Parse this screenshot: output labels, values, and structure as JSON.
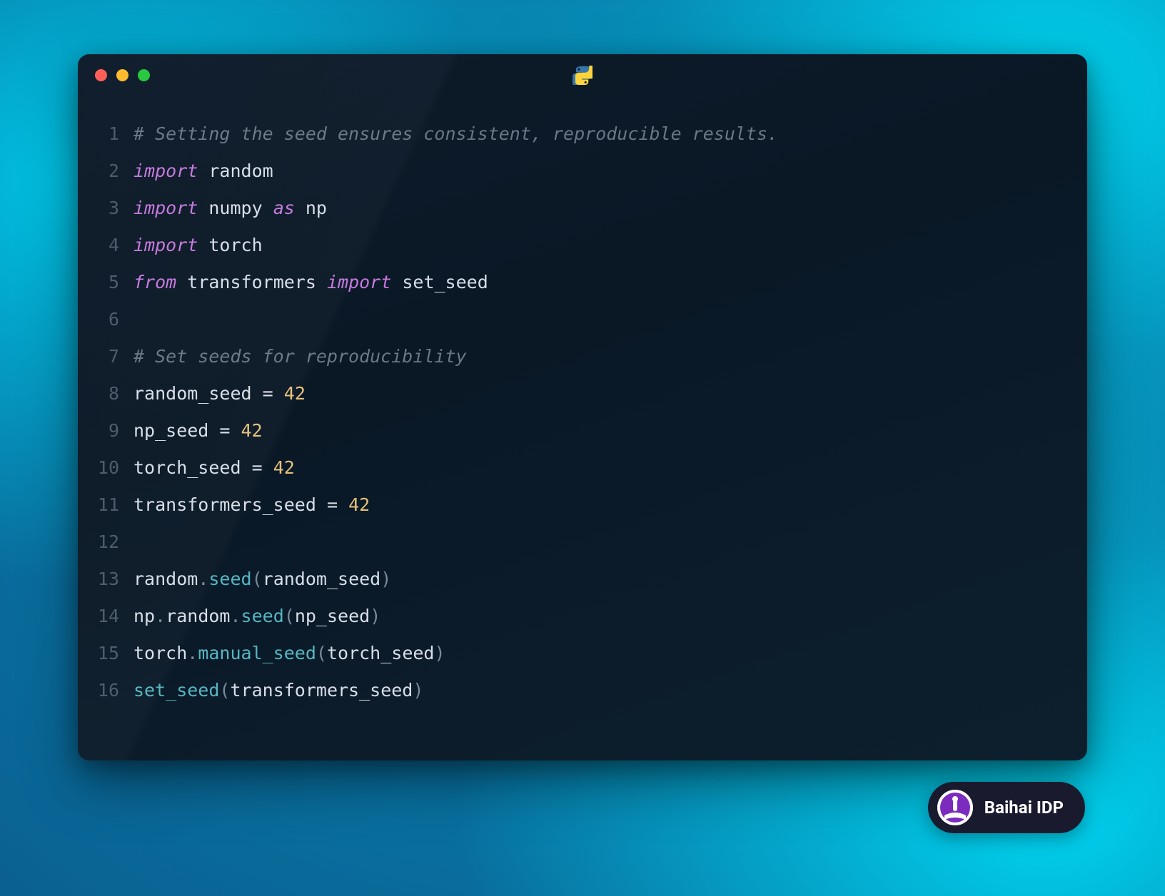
{
  "window": {
    "language": "python"
  },
  "code": {
    "lines": [
      {
        "n": "1",
        "tokens": [
          {
            "t": "comment",
            "v": "# Setting the seed ensures consistent, reproducible results."
          }
        ]
      },
      {
        "n": "2",
        "tokens": [
          {
            "t": "keyword",
            "v": "import"
          },
          {
            "t": "space",
            "v": " "
          },
          {
            "t": "identifier",
            "v": "random"
          }
        ]
      },
      {
        "n": "3",
        "tokens": [
          {
            "t": "keyword",
            "v": "import"
          },
          {
            "t": "space",
            "v": " "
          },
          {
            "t": "identifier",
            "v": "numpy"
          },
          {
            "t": "space",
            "v": " "
          },
          {
            "t": "keyword",
            "v": "as"
          },
          {
            "t": "space",
            "v": " "
          },
          {
            "t": "identifier",
            "v": "np"
          }
        ]
      },
      {
        "n": "4",
        "tokens": [
          {
            "t": "keyword",
            "v": "import"
          },
          {
            "t": "space",
            "v": " "
          },
          {
            "t": "identifier",
            "v": "torch"
          }
        ]
      },
      {
        "n": "5",
        "tokens": [
          {
            "t": "keyword",
            "v": "from"
          },
          {
            "t": "space",
            "v": " "
          },
          {
            "t": "identifier",
            "v": "transformers"
          },
          {
            "t": "space",
            "v": " "
          },
          {
            "t": "keyword",
            "v": "import"
          },
          {
            "t": "space",
            "v": " "
          },
          {
            "t": "identifier",
            "v": "set_seed"
          }
        ]
      },
      {
        "n": "6",
        "tokens": []
      },
      {
        "n": "7",
        "tokens": [
          {
            "t": "comment",
            "v": "# Set seeds for reproducibility"
          }
        ]
      },
      {
        "n": "8",
        "tokens": [
          {
            "t": "identifier",
            "v": "random_seed"
          },
          {
            "t": "space",
            "v": " "
          },
          {
            "t": "operator",
            "v": "="
          },
          {
            "t": "space",
            "v": " "
          },
          {
            "t": "number",
            "v": "42"
          }
        ]
      },
      {
        "n": "9",
        "tokens": [
          {
            "t": "identifier",
            "v": "np_seed"
          },
          {
            "t": "space",
            "v": " "
          },
          {
            "t": "operator",
            "v": "="
          },
          {
            "t": "space",
            "v": " "
          },
          {
            "t": "number",
            "v": "42"
          }
        ]
      },
      {
        "n": "10",
        "tokens": [
          {
            "t": "identifier",
            "v": "torch_seed"
          },
          {
            "t": "space",
            "v": " "
          },
          {
            "t": "operator",
            "v": "="
          },
          {
            "t": "space",
            "v": " "
          },
          {
            "t": "number",
            "v": "42"
          }
        ]
      },
      {
        "n": "11",
        "tokens": [
          {
            "t": "identifier",
            "v": "transformers_seed"
          },
          {
            "t": "space",
            "v": " "
          },
          {
            "t": "operator",
            "v": "="
          },
          {
            "t": "space",
            "v": " "
          },
          {
            "t": "number",
            "v": "42"
          }
        ]
      },
      {
        "n": "12",
        "tokens": []
      },
      {
        "n": "13",
        "tokens": [
          {
            "t": "identifier",
            "v": "random"
          },
          {
            "t": "punct",
            "v": "."
          },
          {
            "t": "method",
            "v": "seed"
          },
          {
            "t": "punct",
            "v": "("
          },
          {
            "t": "identifier",
            "v": "random_seed"
          },
          {
            "t": "punct",
            "v": ")"
          }
        ]
      },
      {
        "n": "14",
        "tokens": [
          {
            "t": "identifier",
            "v": "np"
          },
          {
            "t": "punct",
            "v": "."
          },
          {
            "t": "identifier",
            "v": "random"
          },
          {
            "t": "punct",
            "v": "."
          },
          {
            "t": "method",
            "v": "seed"
          },
          {
            "t": "punct",
            "v": "("
          },
          {
            "t": "identifier",
            "v": "np_seed"
          },
          {
            "t": "punct",
            "v": ")"
          }
        ]
      },
      {
        "n": "15",
        "tokens": [
          {
            "t": "identifier",
            "v": "torch"
          },
          {
            "t": "punct",
            "v": "."
          },
          {
            "t": "method",
            "v": "manual_seed"
          },
          {
            "t": "punct",
            "v": "("
          },
          {
            "t": "identifier",
            "v": "torch_seed"
          },
          {
            "t": "punct",
            "v": ")"
          }
        ]
      },
      {
        "n": "16",
        "tokens": [
          {
            "t": "function",
            "v": "set_seed"
          },
          {
            "t": "punct",
            "v": "("
          },
          {
            "t": "identifier",
            "v": "transformers_seed"
          },
          {
            "t": "punct",
            "v": ")"
          }
        ]
      }
    ]
  },
  "badge": {
    "label": "Baihai IDP"
  },
  "colors": {
    "comment": "#6b7785",
    "keyword": "#c678dd",
    "identifier": "#d8dee9",
    "number": "#e5c07b",
    "punct": "#7a8a9a",
    "method": "#56b6c2",
    "bg_window": "#0d1b2a",
    "badge_bg": "#1a1a2e",
    "badge_accent": "#7b2cbf"
  }
}
